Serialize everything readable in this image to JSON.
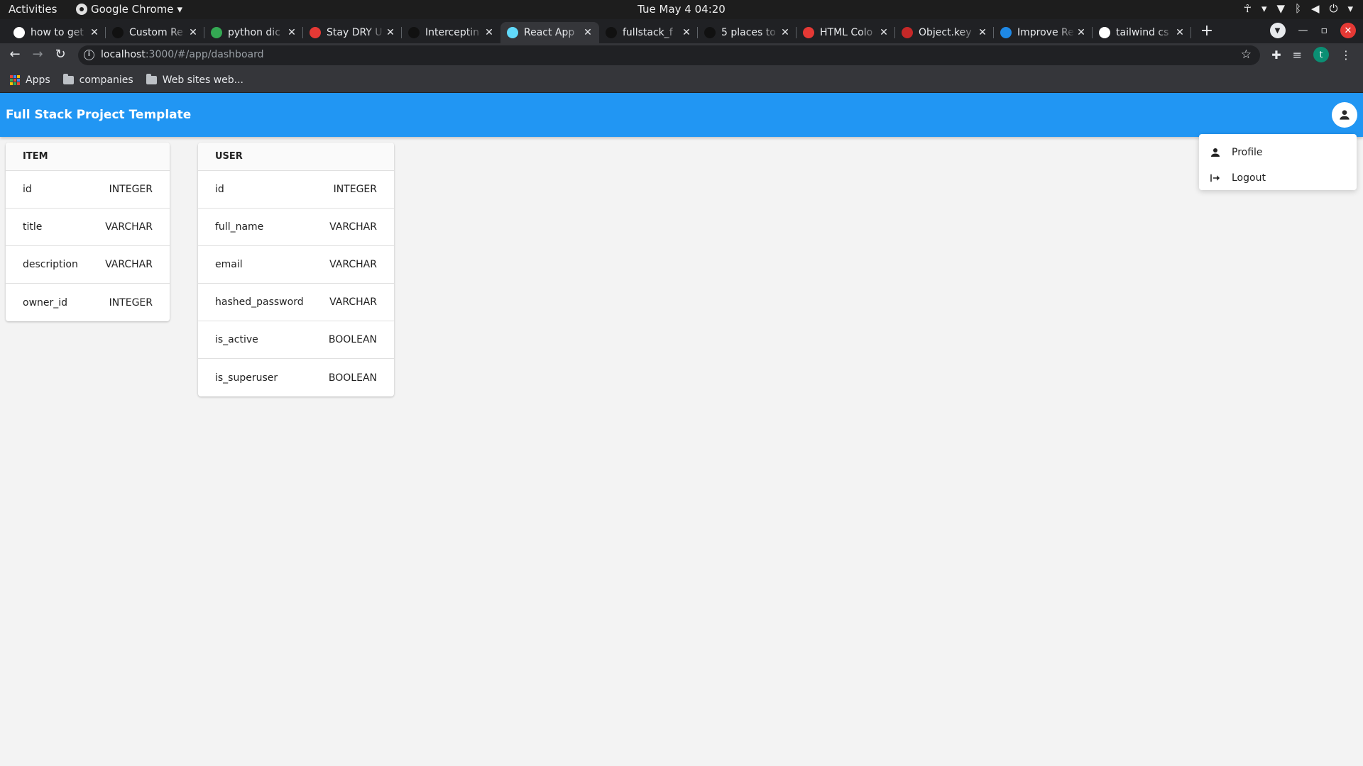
{
  "system_bar": {
    "activities": "Activities",
    "app_name": "Google Chrome",
    "clock": "Tue May 4  04:20"
  },
  "browser": {
    "tabs": [
      {
        "title": "how to get",
        "fav_color": "#ffffff"
      },
      {
        "title": "Custom Re",
        "fav_color": "#111111"
      },
      {
        "title": "python dic",
        "fav_color": "#34a853"
      },
      {
        "title": "Stay DRY U",
        "fav_color": "#e53935"
      },
      {
        "title": "Interceptin",
        "fav_color": "#111111"
      },
      {
        "title": "React App",
        "fav_color": "#61dafb"
      },
      {
        "title": "fullstack_f",
        "fav_color": "#111111"
      },
      {
        "title": "5 places to",
        "fav_color": "#111111"
      },
      {
        "title": "HTML Colo",
        "fav_color": "#e53935"
      },
      {
        "title": "Object.key",
        "fav_color": "#c62828"
      },
      {
        "title": "Improve Re",
        "fav_color": "#1e88e5"
      },
      {
        "title": "tailwind cs",
        "fav_color": "#ffffff"
      }
    ],
    "active_tab_index": 5,
    "url_host": "localhost",
    "url_rest": ":3000/#/app/dashboard",
    "profile_initial": "t",
    "bookmarks": {
      "apps": "Apps",
      "folder1": "companies",
      "folder2": "Web sites web..."
    }
  },
  "app": {
    "title": "Full Stack Project Template",
    "accent": "#2196f3"
  },
  "tables": {
    "item": {
      "name": "ITEM",
      "rows": [
        {
          "name": "id",
          "type": "INTEGER"
        },
        {
          "name": "title",
          "type": "VARCHAR"
        },
        {
          "name": "description",
          "type": "VARCHAR"
        },
        {
          "name": "owner_id",
          "type": "INTEGER"
        }
      ]
    },
    "user": {
      "name": "USER",
      "rows": [
        {
          "name": "id",
          "type": "INTEGER"
        },
        {
          "name": "full_name",
          "type": "VARCHAR"
        },
        {
          "name": "email",
          "type": "VARCHAR"
        },
        {
          "name": "hashed_password",
          "type": "VARCHAR"
        },
        {
          "name": "is_active",
          "type": "BOOLEAN"
        },
        {
          "name": "is_superuser",
          "type": "BOOLEAN"
        }
      ]
    }
  },
  "account_menu": {
    "profile": "Profile",
    "logout": "Logout"
  }
}
